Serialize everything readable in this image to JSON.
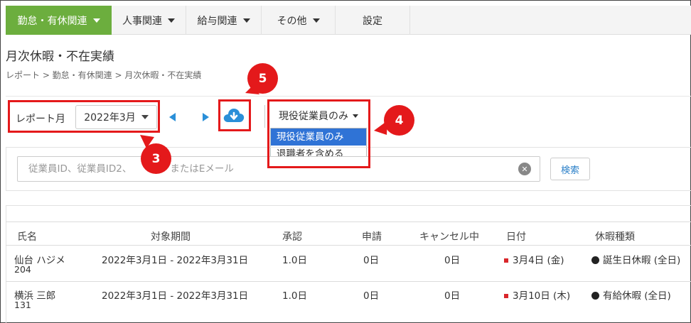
{
  "nav": {
    "items": [
      {
        "label": "勤怠・有休関連",
        "active": true
      },
      {
        "label": "人事関連",
        "active": false
      },
      {
        "label": "給与関連",
        "active": false
      },
      {
        "label": "その他",
        "active": false
      }
    ],
    "settings_label": "設定",
    "active_color": "#6cae3e"
  },
  "page": {
    "title": "月次休暇・不在実績",
    "breadcrumb": "レポート > 勤怠・有休関連 > 月次休暇・不在実績"
  },
  "toolbar": {
    "month_label": "レポート月",
    "month_value": "2022年3月",
    "prev_icon": "triangle-left-icon",
    "next_icon": "triangle-right-icon",
    "download_icon": "cloud-download-icon",
    "filter_value": "現役従業員のみ",
    "filter_options": [
      "現役従業員のみ",
      "退職者を含める"
    ]
  },
  "search": {
    "placeholder": "従業員ID、従業員ID2、",
    "placeholder_tail": "またはEメール",
    "button_label": "検索"
  },
  "table": {
    "headers": [
      "氏名",
      "対象期間",
      "承認",
      "申請",
      "キャンセル中",
      "日付",
      "休暇種類"
    ],
    "rows": [
      {
        "name": "仙台 ハジメ",
        "id": "204",
        "period": "2022年3月1日 - 2022年3月31日",
        "approved": "1.0日",
        "applied": "0日",
        "cancelling": "0日",
        "date": "3月4日 (金)",
        "leave_type": "誕生日休暇 (全日)"
      },
      {
        "name": "横浜 三郎",
        "id": "131",
        "period": "2022年3月1日 - 2022年3月31日",
        "approved": "1.0日",
        "applied": "0日",
        "cancelling": "0日",
        "date": "3月10日 (木)",
        "leave_type": "有給休暇 (全日)"
      }
    ]
  },
  "annotations": {
    "badges": [
      "3",
      "4",
      "5"
    ],
    "color": "#e4191b"
  }
}
